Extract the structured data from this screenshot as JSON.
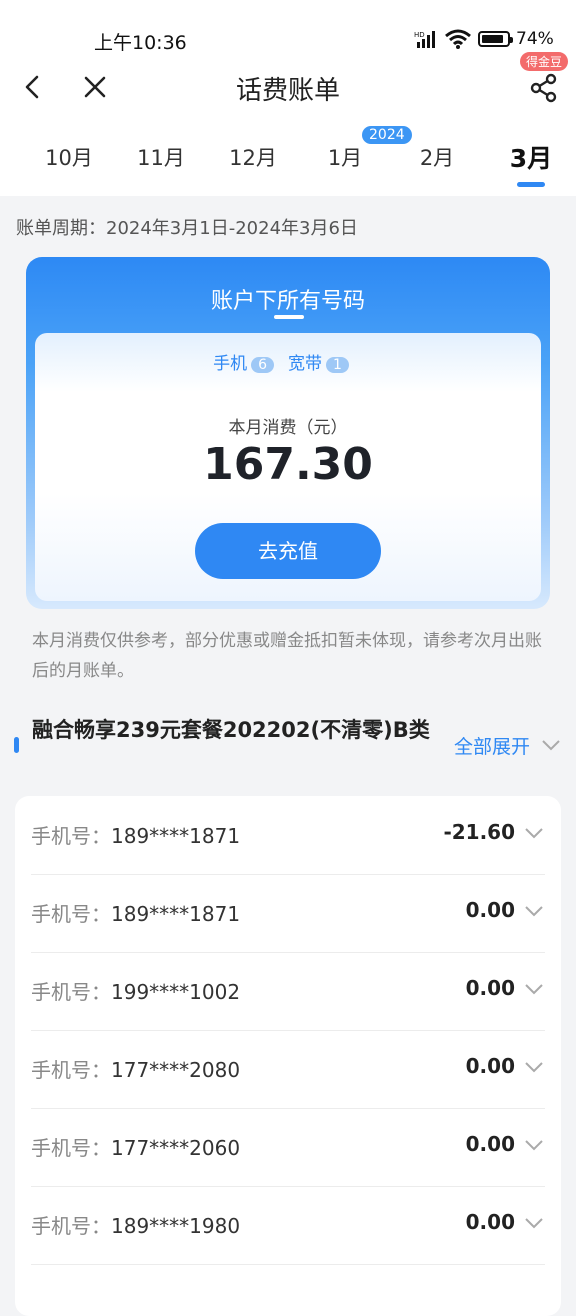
{
  "status_bar": {
    "time": "上午10:36",
    "battery": "74%",
    "battery_level": 0.74
  },
  "nav": {
    "title": "话费账单",
    "badge": "得金豆"
  },
  "months": {
    "items": [
      "10月",
      "11月",
      "12月",
      "1月",
      "2月",
      "3月"
    ],
    "active": "3月",
    "year_badge": "2024"
  },
  "period": "账单周期：2024年3月1日-2024年3月6日",
  "card": {
    "title": "账户下所有号码",
    "phone_label": "手机",
    "phone_count": "6",
    "broadband_label": "宽带",
    "broadband_count": "1",
    "consume_label": "本月消费（元）",
    "amount": "167.30",
    "recharge_label": "去充值"
  },
  "note": "本月消费仅供参考，部分优惠或赠金抵扣暂未体现，请参考次月出账后的月账单。",
  "plan": {
    "title": "融合畅享239元套餐202202(不清零)B类",
    "expand_label": "全部展开"
  },
  "rows": [
    {
      "label": "手机号：",
      "number": "189****1871",
      "amount": "-21.60"
    },
    {
      "label": "手机号：",
      "number": "189****1871",
      "amount": "0.00"
    },
    {
      "label": "手机号：",
      "number": "199****1002",
      "amount": "0.00"
    },
    {
      "label": "手机号：",
      "number": "177****2080",
      "amount": "0.00"
    },
    {
      "label": "手机号：",
      "number": "177****2060",
      "amount": "0.00"
    },
    {
      "label": "手机号：",
      "number": "189****1980",
      "amount": "0.00"
    }
  ],
  "colors": {
    "accent": "#2f88f3",
    "badge": "#f36b6b"
  }
}
